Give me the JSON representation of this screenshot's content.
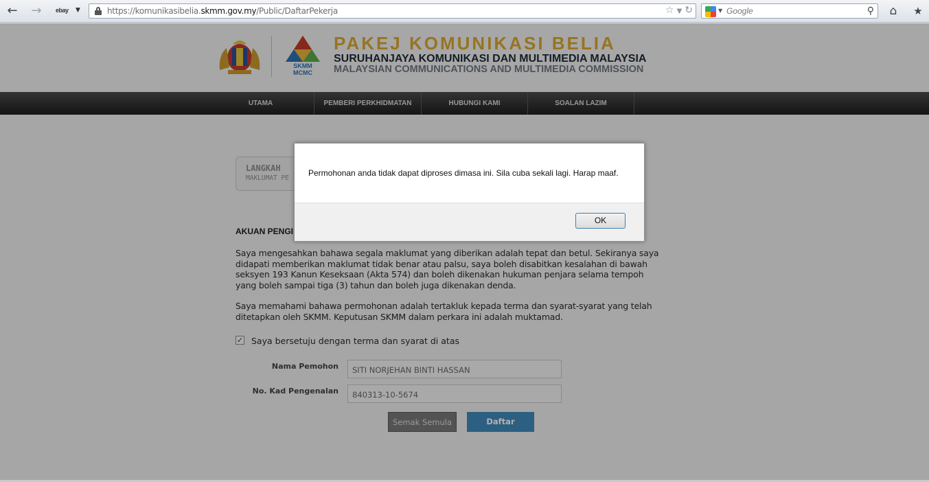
{
  "browser": {
    "back_icon": "arrow-left",
    "forward_icon": "arrow-right",
    "search_engine_label": "ebay",
    "url_prefix": "https://komunikasibelia.",
    "url_domain": "skmm.gov.my",
    "url_path": "/Public/DaftarPekerja",
    "search_placeholder": "Google"
  },
  "header": {
    "title": "PAKEJ KOMUNIKASI BELIA",
    "org_name_malay": "SURUHANJAYA KOMUNIKASI DAN MULTIMEDIA MALAYSIA",
    "org_name_english": "MALAYSIAN COMMUNICATIONS AND MULTIMEDIA COMMISSION",
    "logo_text_top": "SKMM",
    "logo_text_bottom": "MCMC"
  },
  "nav": {
    "items": [
      {
        "label": "UTAMA"
      },
      {
        "label": "PEMBERI PERKHIDMATAN"
      },
      {
        "label": "HUBUNGI KAMI"
      },
      {
        "label": "SOALAN LAZIM"
      }
    ]
  },
  "step": {
    "title": "LANGKAH",
    "subtitle": "MAKLUMAT PE"
  },
  "form": {
    "section_title": "AKUAN PENGI",
    "para1": "Saya mengesahkan bahawa segala maklumat yang diberikan adalah tepat dan betul. Sekiranya saya didapati memberikan maklumat tidak benar atau palsu, saya boleh disabitkan kesalahan di bawah seksyen 193 Kanun Keseksaan (Akta 574) dan boleh dikenakan hukuman penjara selama tempoh yang boleh sampai tiga (3) tahun dan boleh juga dikenakan denda.",
    "para2": "Saya memahami bahawa permohonan adalah tertakluk kepada terma dan syarat-syarat yang telah ditetapkan oleh SKMM. Keputusan SKMM dalam perkara ini adalah muktamad.",
    "agree_label": "Saya bersetuju dengan terma dan syarat di atas",
    "agree_checked": true,
    "name_label": "Nama Pemohon",
    "name_value": "SITI NORJEHAN BINTI HASSAN",
    "ic_label": "No. Kad Pengenalan",
    "ic_value": "840313-10-5674",
    "reset_label": "Semak Semula",
    "submit_label": "Daftar"
  },
  "dialog": {
    "message": "Permohonan anda tidak dapat diproses dimasa ini. Sila cuba sekali lagi. Harap maaf.",
    "ok_label": "OK"
  }
}
